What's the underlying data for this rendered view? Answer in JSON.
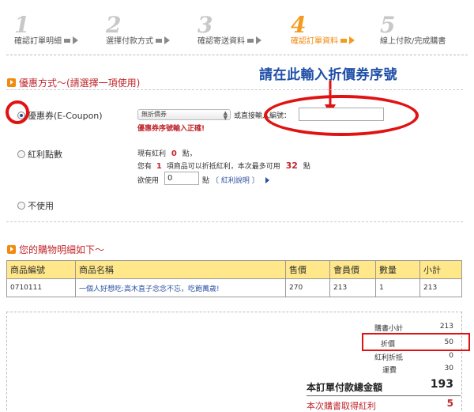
{
  "steps": [
    {
      "num": "1",
      "label": "確認訂單明細"
    },
    {
      "num": "2",
      "label": "選擇付款方式"
    },
    {
      "num": "3",
      "label": "確認寄送資料"
    },
    {
      "num": "4",
      "label": "確認訂單資料"
    },
    {
      "num": "5",
      "label": "線上付款/完成購書"
    }
  ],
  "active_step": 4,
  "annotation": "請在此輸入折價券序號",
  "discount": {
    "title": "優惠方式～(請選擇一項使用)",
    "coupon_label": "優惠券(E-Coupon)",
    "coupon_select": "無折價券",
    "coupon_or_text": "或直接輸入編號：",
    "coupon_input_value": "",
    "coupon_message": "優惠券序號輸入正確!",
    "bonus_label": "紅利點數",
    "bonus_line1_pre": "現有紅利",
    "bonus_line1_value": "0",
    "bonus_line1_post": "點，",
    "bonus_line2_pre": "您有",
    "bonus_line2_count": "1",
    "bonus_line2_mid": "項商品可以折抵紅利，本次最多可用",
    "bonus_line2_max": "32",
    "bonus_line2_post": "點",
    "bonus_line3_pre": "欲使用",
    "bonus_input_value": "0",
    "bonus_line3_post": "點",
    "bonus_link": "〔 紅利說明 〕",
    "none_label": "不使用"
  },
  "cart": {
    "title": "您的購物明細如下～",
    "headers": [
      "商品編號",
      "商品名稱",
      "售價",
      "會員價",
      "數量",
      "小計"
    ],
    "rows": [
      [
        "0710111",
        "一個人好想吃:高木直子念念不忘，吃飽萬歲!",
        "270",
        "213",
        "1",
        "213"
      ]
    ]
  },
  "summary": {
    "subtotal_label": "購書小計",
    "subtotal_value": "213",
    "discount_label": "折價",
    "discount_value": "50",
    "bonus_label": "紅利折抵",
    "bonus_value": "0",
    "shipping_label": "運費",
    "shipping_value": "30",
    "total_label": "本訂單付款總金額",
    "total_value": "193",
    "earn_label": "本次購書取得紅利",
    "earn_value": "5"
  },
  "colors": {
    "accent": "#f59a1c",
    "red": "#c1272d",
    "annotation": "#e01212",
    "link": "#2a4fa0",
    "header_bg": "#ffe78a"
  }
}
